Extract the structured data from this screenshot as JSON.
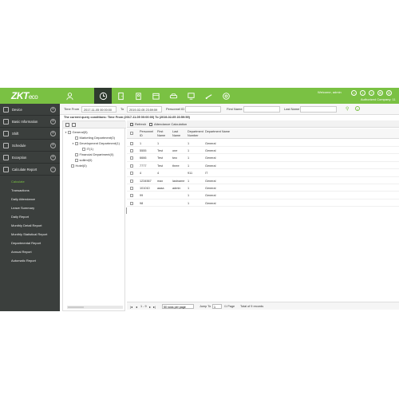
{
  "brand": {
    "logo_main": "ZKT",
    "logo_eco": "eco",
    "accent": "#7ac143",
    "sidebar_bg": "#3b3f3d"
  },
  "topnav": {
    "icons": [
      "person-icon",
      "clock-icon",
      "door-icon",
      "badge-icon",
      "calendar-icon",
      "car-icon",
      "monitor-icon",
      "parking-icon",
      "target-icon"
    ],
    "welcome": "Welcome, admin",
    "company": "Authorized Company: 11",
    "actions": [
      "home-icon",
      "info-icon",
      "help-icon",
      "settings-icon",
      "logout-icon"
    ]
  },
  "sidebar": {
    "items": [
      {
        "label": "Device"
      },
      {
        "label": "Basic Information"
      },
      {
        "label": "Shift"
      },
      {
        "label": "Schedule"
      },
      {
        "label": "Exception"
      },
      {
        "label": "Calculate Report"
      }
    ],
    "subitems": [
      {
        "label": "Calculate",
        "active": true
      },
      {
        "label": "Transactions"
      },
      {
        "label": "Daily Attendance"
      },
      {
        "label": "Leave Summary"
      },
      {
        "label": "Daily Report"
      },
      {
        "label": "Monthly Detail Report"
      },
      {
        "label": "Monthly Statistical Report"
      },
      {
        "label": "Departmental Report"
      },
      {
        "label": "Annual Report"
      },
      {
        "label": "Automatic Report"
      }
    ]
  },
  "query": {
    "time_from_label": "Time From",
    "time_from_value": "2017-11-05 00:00:00",
    "to_label": "To",
    "to_value": "2019-02-05 23:59:59",
    "personnel_id_label": "Personnel ID",
    "personnel_id_value": "",
    "first_name_label": "First Name",
    "first_name_value": "",
    "last_name_label": "Last Name",
    "last_name_value": "",
    "conditions": "The current query conditions: Time From (2017-11-05 00:00:00) To (2019-02-05 23:59:59)"
  },
  "tree": {
    "nodes": [
      {
        "label": "General(5)",
        "arrow": "▼",
        "level": 0
      },
      {
        "label": "Marketing Department(0)",
        "arrow": "",
        "level": 1
      },
      {
        "label": "Development Department(1)",
        "arrow": "▼",
        "level": 1
      },
      {
        "label": "IT(1)",
        "arrow": "",
        "level": 2
      },
      {
        "label": "Financial Department(0)",
        "arrow": "",
        "level": 1
      },
      {
        "label": "sollimi(0)",
        "arrow": "",
        "level": 1
      },
      {
        "label": "Hotel(0)",
        "arrow": "",
        "level": 0
      }
    ]
  },
  "grid": {
    "toolbar": {
      "refresh": "Refresh",
      "calc": "Attendance Calculation"
    },
    "headers": [
      "Personnel ID",
      "First Name",
      "Last Name",
      "Department Number",
      "Department Name"
    ],
    "rows": [
      [
        "1",
        "1",
        "",
        "1",
        "General"
      ],
      [
        "5555",
        "Test",
        "one",
        "1",
        "General"
      ],
      [
        "6666",
        "Test",
        "two",
        "1",
        "General"
      ],
      [
        "7777",
        "Test",
        "three",
        "1",
        "General"
      ],
      [
        "4",
        "4",
        "",
        "911",
        "IT"
      ],
      [
        "1234567",
        "max",
        "lastname",
        "1",
        "General"
      ],
      [
        "101010",
        "aaaa",
        "admin",
        "1",
        "General"
      ],
      [
        "99",
        "",
        "",
        "1",
        "General"
      ],
      [
        "98",
        "",
        "",
        "1",
        "General"
      ]
    ],
    "footer": {
      "pager": "1 - 9",
      "rows_per_page": "50 rows per page",
      "jump_to_label": "Jump To",
      "jump_to_value": "1",
      "pages": "/1 Page",
      "total": "Total of 9 records"
    }
  }
}
